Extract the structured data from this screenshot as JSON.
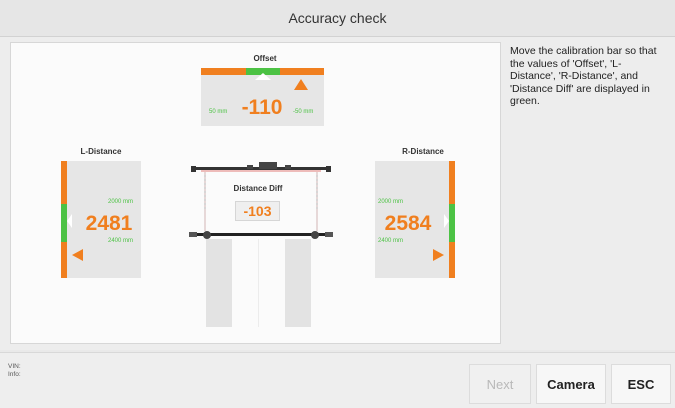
{
  "window": {
    "title": "Accuracy check"
  },
  "instruction": "Move the calibration bar so that the values of 'Offset', 'L-Distance', 'R-Distance', and 'Distance Diff' are displayed in green.",
  "offset": {
    "label": "Offset",
    "value": "-110",
    "left_limit": "50 mm",
    "right_limit": "-50 mm"
  },
  "l_distance": {
    "label": "L-Distance",
    "value": "2481",
    "upper_limit": "2000 mm",
    "lower_limit": "2400 mm"
  },
  "r_distance": {
    "label": "R-Distance",
    "value": "2584",
    "upper_limit": "2000 mm",
    "lower_limit": "2400 mm"
  },
  "distance_diff": {
    "label": "Distance Diff",
    "value": "-103"
  },
  "footer": {
    "vin_label": "VIN:",
    "info_label": "Info:",
    "next_label": "Next",
    "camera_label": "Camera",
    "esc_label": "ESC"
  },
  "colors": {
    "accent_orange": "#f07f1f",
    "accent_green": "#4cc244"
  }
}
